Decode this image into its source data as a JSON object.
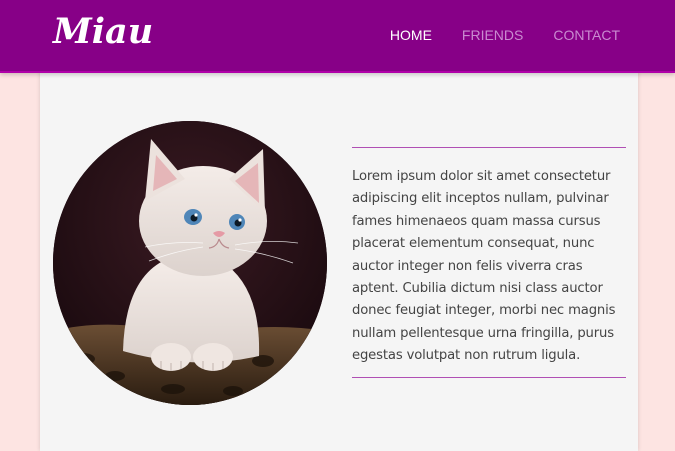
{
  "brand": {
    "logo_text": "Miau"
  },
  "nav": {
    "items": [
      {
        "label": "HOME",
        "active": true
      },
      {
        "label": "FRIENDS",
        "active": false
      },
      {
        "label": "CONTACT",
        "active": false
      }
    ]
  },
  "article": {
    "image_icon": "kitten-photo",
    "body": "Lorem ipsum dolor sit amet consectetur adipiscing elit inceptos nullam, pulvinar fames himenaeos quam massa cursus placerat elementum consequat, nunc auctor integer non felis viverra cras aptent. Cubilia dictum nisi class auctor donec feugiat integer, morbi nec magnis nullam pellentesque urna fringilla, purus egestas volutpat non rutrum ligula."
  },
  "colors": {
    "header_bg": "#870087",
    "page_bg": "#fde4e2",
    "content_bg": "#f5f5f5",
    "divider": "#b04fb4",
    "nav_inactive": "#c98ad0"
  }
}
